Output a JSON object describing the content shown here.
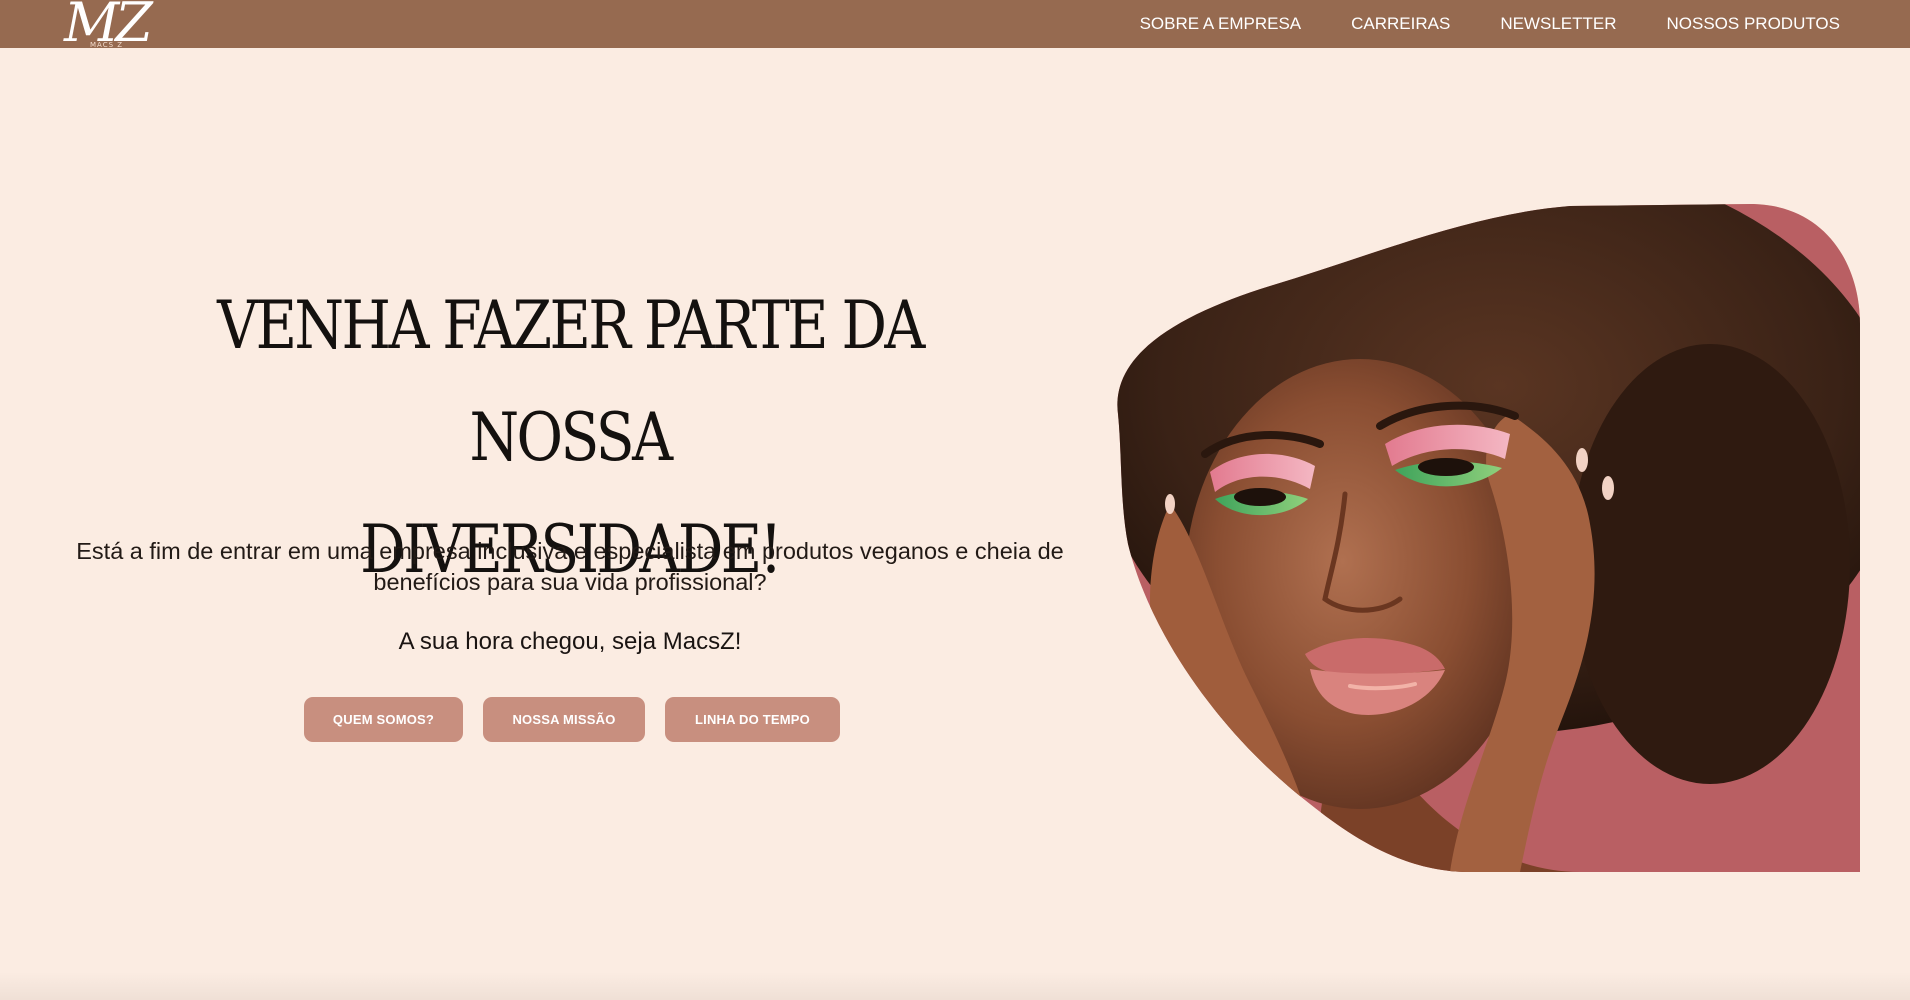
{
  "brand": {
    "logo_text": "MZ",
    "logo_subtext": "MACS Z"
  },
  "nav": {
    "items": [
      {
        "label": "SOBRE A EMPRESA"
      },
      {
        "label": "CARREIRAS"
      },
      {
        "label": "NEWSLETTER"
      },
      {
        "label": "NOSSOS PRODUTOS"
      }
    ]
  },
  "hero": {
    "title_line1": "VENHA FAZER PARTE DA NOSSA",
    "title_line2": "DIVERSIDADE!",
    "description_line1": "Está a fim de entrar em uma empresa inclusiva e especialista em produtos veganos e cheia de",
    "description_line2": "benefícios para sua vida profissional?",
    "cta_text": "A sua hora chegou, seja MacsZ!",
    "buttons": [
      {
        "label": "QUEM SOMOS?"
      },
      {
        "label": "NOSSA MISSÃO"
      },
      {
        "label": "LINHA DO TEMPO"
      }
    ],
    "image": {
      "subject": "woman with afro hair and pink-green eye makeup",
      "colors": {
        "backdrop": "#e8bea5",
        "background": "#b95f63",
        "hair": "#3a2216",
        "skin": "#9a5a3b"
      }
    }
  },
  "colors": {
    "navbar": "#966a50",
    "page_background": "#fbece2",
    "button": "#c88f7f",
    "title": "#14110f"
  }
}
